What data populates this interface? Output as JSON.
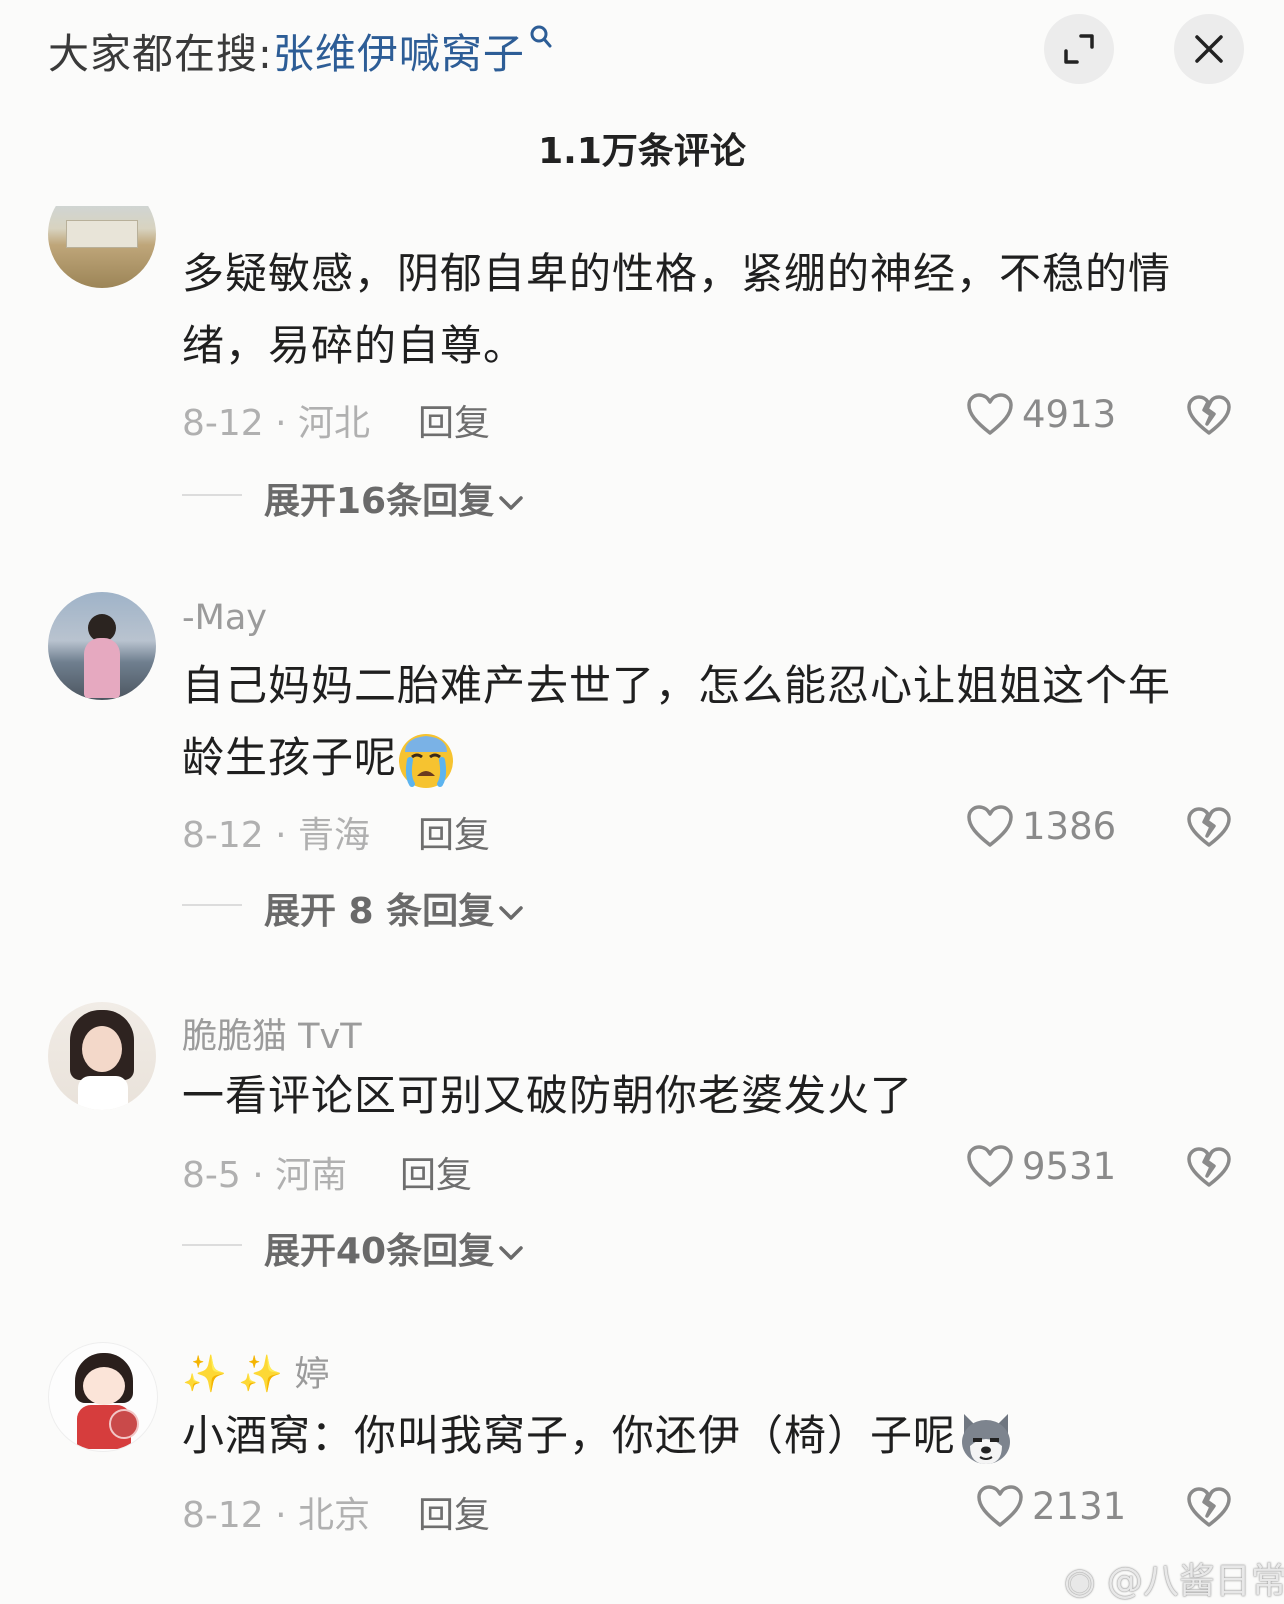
{
  "header": {
    "search_prefix": "大家都在搜",
    "search_sep": ":",
    "search_term": "张维伊喊窝子",
    "expand_icon": "expand-icon",
    "close_icon": "close-icon"
  },
  "comments_title": "1.1万条评论",
  "comments": [
    {
      "username": "",
      "text": "多疑敏感，阴郁自卑的性格，紧绷的神经，不稳的情绪，易碎的自尊。",
      "date_location": "8-12 · 河北",
      "reply_label": "回复",
      "likes": "4913",
      "expand_label": "展开16条回复"
    },
    {
      "username": "-May",
      "text": "自己妈妈二胎难产去世了，怎么能忍心让姐姐这个年龄生孩子呢",
      "emoji": "crying-face-emoji",
      "date_location": "8-12 · 青海",
      "reply_label": "回复",
      "likes": "1386",
      "expand_label": "展开 8 条回复"
    },
    {
      "username": "脆脆猫 TvT",
      "text": "一看评论区可别又破防朝你老婆发火了",
      "date_location": "8-5 · 河南",
      "reply_label": "回复",
      "likes": "9531",
      "expand_label": "展开40条回复"
    },
    {
      "username": "婷",
      "username_icons": "sparkles-icon",
      "text": "小酒窝：你叫我窝子，你还伊（椅）子呢",
      "emoji": "dog-face-emoji",
      "date_location": "8-12 · 北京",
      "reply_label": "回复",
      "likes": "2131"
    }
  ],
  "watermark": "@八酱日常",
  "colors": {
    "accent_link": "#2d5d96",
    "background": "#fbfbfa",
    "meta_text": "#b0b0b0"
  }
}
